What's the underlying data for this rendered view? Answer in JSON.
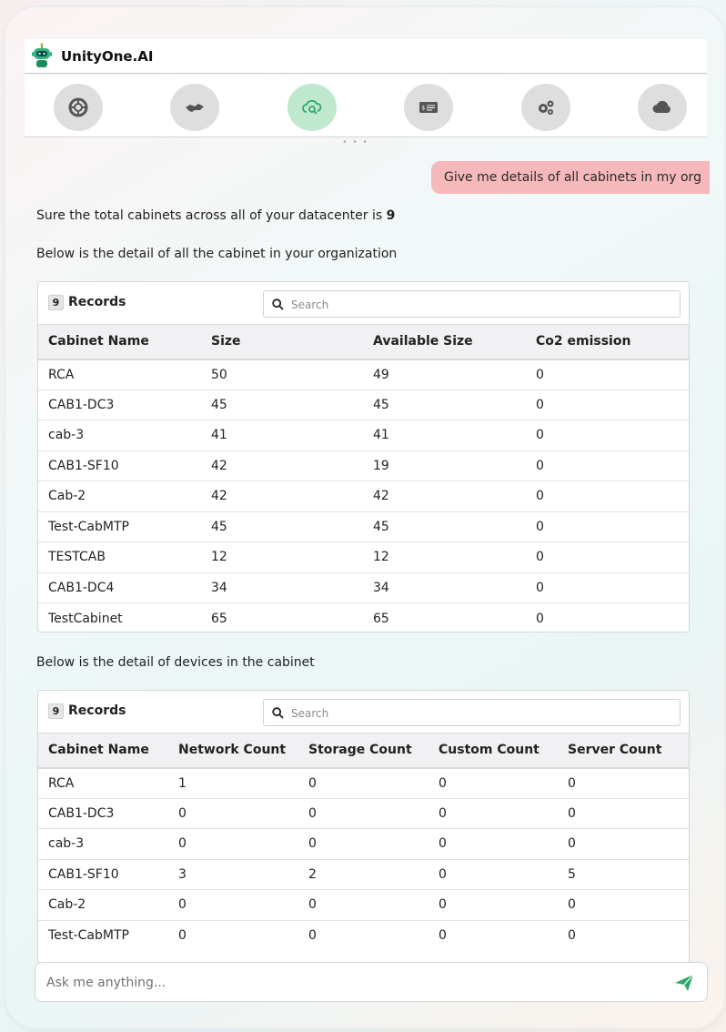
{
  "app": {
    "title": "UnityOne.AI"
  },
  "nav": {
    "items": [
      {
        "icon": "lifebuoy-icon",
        "active": false
      },
      {
        "icon": "handshake-icon",
        "active": false
      },
      {
        "icon": "cloud-search-icon",
        "active": true
      },
      {
        "icon": "billing-icon",
        "active": false
      },
      {
        "icon": "gears-icon",
        "active": false
      },
      {
        "icon": "cloud-icon",
        "active": false
      }
    ]
  },
  "chat": {
    "user_message": "Give me details of all cabinets in my org",
    "reply_total_prefix": "Sure the total cabinets across all of your datacenter is ",
    "reply_total_value": "9",
    "reply_cabinets_intro": "Below is the detail of all the cabinet in your organization",
    "reply_devices_intro": "Below is the detail of devices in the cabinet"
  },
  "cabinets_table": {
    "record_count": "9",
    "records_label": "Records",
    "search_placeholder": "Search",
    "columns": [
      "Cabinet Name",
      "Size",
      "Available Size",
      "Co2 emission"
    ],
    "rows": [
      [
        "RCA",
        "50",
        "49",
        "0"
      ],
      [
        "CAB1-DC3",
        "45",
        "45",
        "0"
      ],
      [
        "cab-3",
        "41",
        "41",
        "0"
      ],
      [
        "CAB1-SF10",
        "42",
        "19",
        "0"
      ],
      [
        "Cab-2",
        "42",
        "42",
        "0"
      ],
      [
        "Test-CabMTP",
        "45",
        "45",
        "0"
      ],
      [
        "TESTCAB",
        "12",
        "12",
        "0"
      ],
      [
        "CAB1-DC4",
        "34",
        "34",
        "0"
      ],
      [
        "TestCabinet",
        "65",
        "65",
        "0"
      ]
    ]
  },
  "devices_table": {
    "record_count": "9",
    "records_label": "Records",
    "search_placeholder": "Search",
    "columns": [
      "Cabinet Name",
      "Network Count",
      "Storage Count",
      "Custom Count",
      "Server Count"
    ],
    "rows": [
      [
        "RCA",
        "1",
        "0",
        "0",
        "0"
      ],
      [
        "CAB1-DC3",
        "0",
        "0",
        "0",
        "0"
      ],
      [
        "cab-3",
        "0",
        "0",
        "0",
        "0"
      ],
      [
        "CAB1-SF10",
        "3",
        "2",
        "0",
        "5"
      ],
      [
        "Cab-2",
        "0",
        "0",
        "0",
        "0"
      ],
      [
        "Test-CabMTP",
        "0",
        "0",
        "0",
        "0"
      ]
    ]
  },
  "input": {
    "placeholder": "Ask me anything..."
  },
  "colors": {
    "accent": "#2fa86a",
    "user_bubble": "#f5b8bb",
    "active_nav": "#bfe8cf"
  }
}
